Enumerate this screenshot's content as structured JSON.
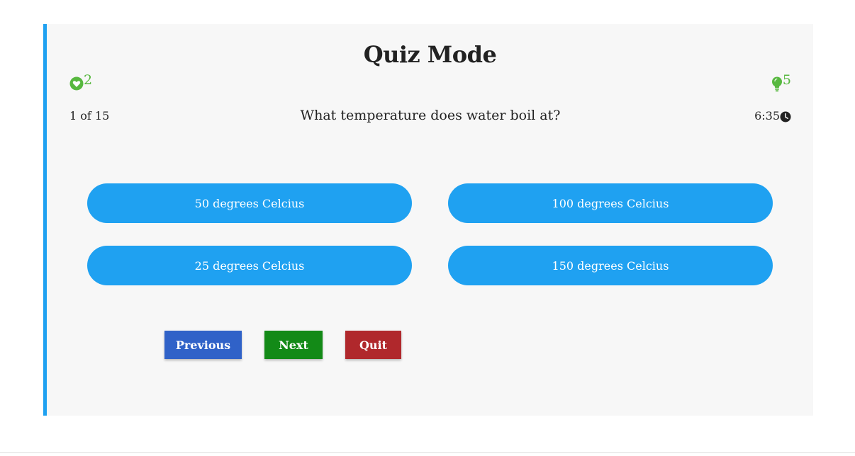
{
  "quiz": {
    "title": "Quiz Mode",
    "lives": "2",
    "hints": "5",
    "progress": "1 of 15",
    "question": "What temperature does water boil at?",
    "timer": "6:35"
  },
  "options": [
    {
      "label": "50 degrees Celcius"
    },
    {
      "label": "100 degrees Celcius"
    },
    {
      "label": "25 degrees Celcius"
    },
    {
      "label": "150 degrees Celcius"
    }
  ],
  "buttons": {
    "previous": "Previous",
    "next": "Next",
    "quit": "Quit"
  },
  "icons": {
    "lives": "heart-circle-icon",
    "hints": "lightbulb-icon",
    "timer": "clock-icon"
  },
  "colors": {
    "accent": "#1fa1f1",
    "stat_green": "#57b83f",
    "previous": "#3062c8",
    "next": "#138a17",
    "quit": "#b0282c"
  }
}
